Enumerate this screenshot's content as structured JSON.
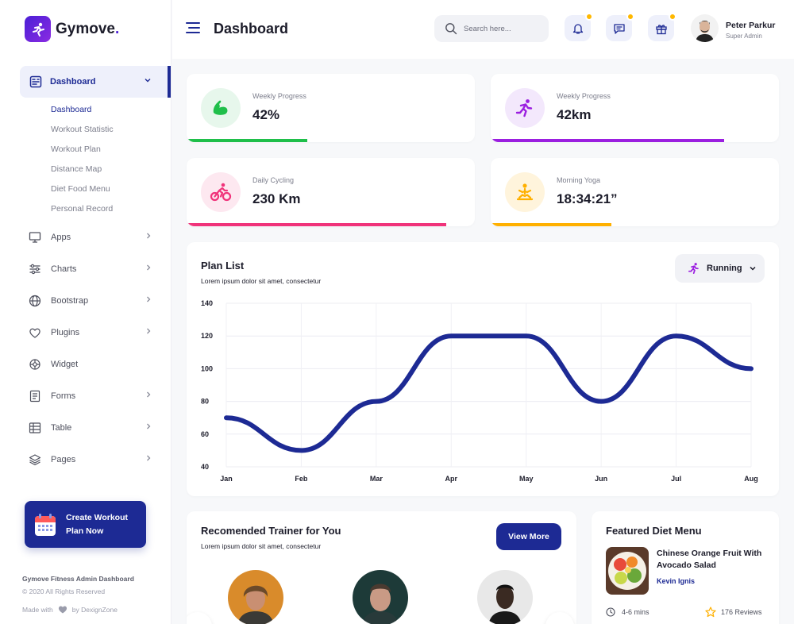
{
  "brand": {
    "name": "Gymove",
    "dot": "."
  },
  "sidebar": {
    "active": {
      "label": "Dashboard",
      "icon": "dashboard-icon"
    },
    "submenu": [
      "Dashboard",
      "Workout Statistic",
      "Workout Plan",
      "Distance Map",
      "Diet Food Menu",
      "Personal Record"
    ],
    "items": [
      {
        "label": "Apps",
        "icon": "monitor-icon",
        "has_chevron": true
      },
      {
        "label": "Charts",
        "icon": "sliders-icon",
        "has_chevron": true
      },
      {
        "label": "Bootstrap",
        "icon": "globe-icon",
        "has_chevron": true
      },
      {
        "label": "Plugins",
        "icon": "heart-icon",
        "has_chevron": true
      },
      {
        "label": "Widget",
        "icon": "widget-icon",
        "has_chevron": false
      },
      {
        "label": "Forms",
        "icon": "forms-icon",
        "has_chevron": true
      },
      {
        "label": "Table",
        "icon": "table-icon",
        "has_chevron": true
      },
      {
        "label": "Pages",
        "icon": "layers-icon",
        "has_chevron": true
      }
    ],
    "cta": {
      "line1": "Create Workout",
      "line2": "Plan Now"
    },
    "footer": {
      "title": "Gymove Fitness Admin Dashboard",
      "copy": "© 2020 All Rights Reserved",
      "made_prefix": "Made with",
      "made_suffix": "by DexignZone"
    }
  },
  "header": {
    "title": "Dashboard",
    "search_placeholder": "Search here...",
    "user": {
      "name": "Peter Parkur",
      "role": "Super Admin"
    }
  },
  "stats": [
    {
      "label": "Weekly Progress",
      "value": "42%",
      "color": "#1fbf4a",
      "bg": "#e7f7ec",
      "progress": 0.42,
      "icon": "muscle-icon"
    },
    {
      "label": "Weekly Progress",
      "value": "42km",
      "color": "#9b1fe0",
      "bg": "#f3e8fc",
      "progress": 0.81,
      "icon": "runner-icon"
    },
    {
      "label": "Daily Cycling",
      "value": "230 Km",
      "color": "#f0337a",
      "bg": "#fde8f0",
      "progress": 0.9,
      "icon": "cycling-icon"
    },
    {
      "label": "Morning Yoga",
      "value": "18:34:21”",
      "color": "#ffb000",
      "bg": "#fff4dc",
      "progress": 0.42,
      "icon": "yoga-icon"
    }
  ],
  "plan": {
    "title": "Plan List",
    "subtitle": "Lorem ipsum dolor sit amet, consectetur",
    "dropdown": "Running"
  },
  "chart_data": {
    "type": "line",
    "categories": [
      "Jan",
      "Feb",
      "Mar",
      "Apr",
      "May",
      "Jun",
      "Jul",
      "Aug"
    ],
    "series": [
      {
        "values": [
          70,
          50,
          80,
          120,
          120,
          80,
          120,
          100
        ],
        "color": "#1d2a94"
      }
    ],
    "ylim": [
      40,
      140
    ],
    "yticks": [
      40,
      60,
      80,
      100,
      120,
      140
    ],
    "grid": true
  },
  "trainers": {
    "title": "Recomended Trainer for You",
    "subtitle": "Lorem ipsum dolor sit amet, consectetur",
    "button": "View More"
  },
  "diet": {
    "title": "Featured Diet Menu",
    "name": "Chinese Orange Fruit With Avocado Salad",
    "author": "Kevin Ignis",
    "time": "4-6 mins",
    "reviews": "176 Reviews"
  }
}
